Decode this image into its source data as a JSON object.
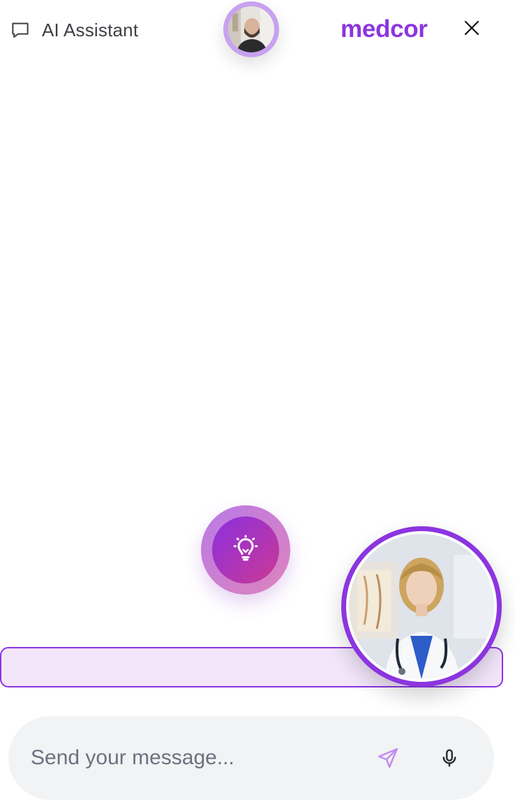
{
  "header": {
    "title": "AI Assistant",
    "brand": "medcor"
  },
  "icons": {
    "chat": "chat-bubble-icon",
    "close": "close-icon",
    "idea": "lightbulb-icon",
    "send": "send-icon",
    "mic": "microphone-icon"
  },
  "colors": {
    "brand": "#8b35e0",
    "status_bar_bg": "#f3e6fb",
    "input_bg": "#f2f3f5",
    "idea_gradient_start": "#8a2fe0",
    "idea_gradient_end": "#cc3a93"
  },
  "composer": {
    "placeholder": "Send your message..."
  }
}
